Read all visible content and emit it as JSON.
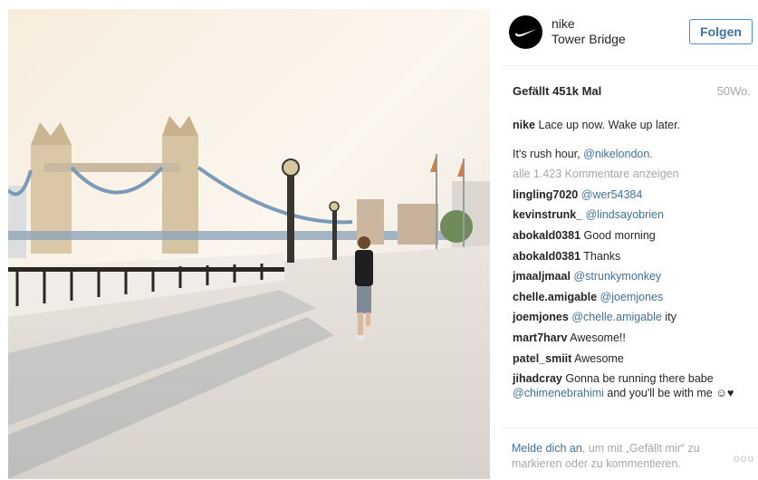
{
  "header": {
    "username": "nike",
    "location": "Tower Bridge",
    "follow_label": "Folgen"
  },
  "stats": {
    "likes": "Gefällt 451k Mal",
    "age": "50Wo."
  },
  "caption": {
    "user": "nike",
    "text": "Lace up now. Wake up later."
  },
  "caption2": {
    "text": "It's rush hour,",
    "mention": "@nikelondon."
  },
  "view_all": "alle 1.423 Kommentare anzeigen",
  "comments": [
    {
      "user": "lingling7020",
      "mention": "@wer54384",
      "text": ""
    },
    {
      "user": "kevinstrunk_",
      "mention": "@lindsayobrien",
      "text": ""
    },
    {
      "user": "abokald0381",
      "mention": "",
      "text": "Good morning"
    },
    {
      "user": "abokald0381",
      "mention": "",
      "text": "Thanks"
    },
    {
      "user": "jmaaljmaal",
      "mention": "@strunkymonkey",
      "text": ""
    },
    {
      "user": "chelle.amigable",
      "mention": "@joemjones",
      "text": ""
    },
    {
      "user": "joemjones",
      "mention": "@chelle.amigable",
      "text": "ity"
    },
    {
      "user": "mart7harv",
      "mention": "",
      "text": "Awesome!!"
    },
    {
      "user": "patel_smiit",
      "mention": "",
      "text": "Awesome"
    }
  ],
  "last_comment": {
    "user": "jihadcray",
    "text1": "Gonna be running there babe",
    "mention": "@chimenebrahimi",
    "text2": "and you'll be with me",
    "emoji": "☺♥"
  },
  "footer": {
    "login_link": "Melde dich an",
    "login_text": ", um mit „Gefällt mir“ zu markieren oder zu kommentieren.",
    "more": "ooo"
  },
  "icons": {
    "avatar": "nike-swoosh-icon",
    "more": "more-options-icon"
  }
}
